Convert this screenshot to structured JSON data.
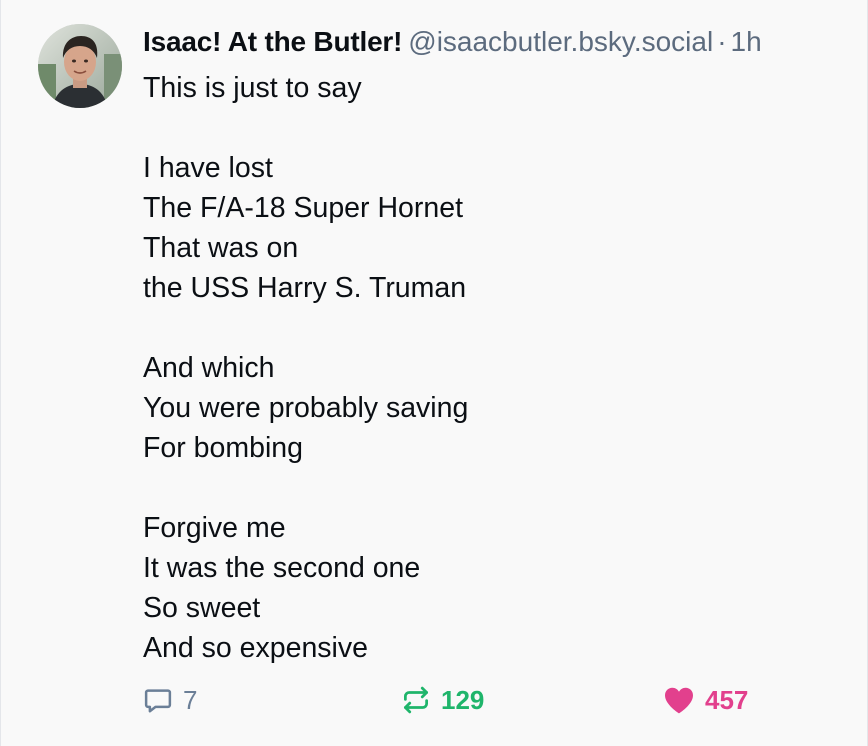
{
  "post": {
    "author": {
      "display_name": "Isaac! At the Butler!",
      "handle": "@isaacbutler.bsky.social",
      "avatar_icon": "user-avatar"
    },
    "separator": "·",
    "time": "1h",
    "lines": [
      "This is just to say",
      "",
      "I have lost",
      "The F/A-18 Super Hornet",
      "That was on",
      "the USS Harry S. Truman",
      "",
      "And which",
      "You were probably saving",
      "For bombing",
      "",
      "Forgive me",
      "It was the second one",
      "So sweet",
      "And so expensive"
    ],
    "actions": {
      "reply": {
        "icon": "speech-bubble-icon",
        "count": "7",
        "color": "#6b7f97"
      },
      "repost": {
        "icon": "repost-arrows-icon",
        "count": "129",
        "color": "#1fb56b"
      },
      "like": {
        "icon": "heart-icon",
        "count": "457",
        "color": "#e2408d"
      }
    }
  }
}
